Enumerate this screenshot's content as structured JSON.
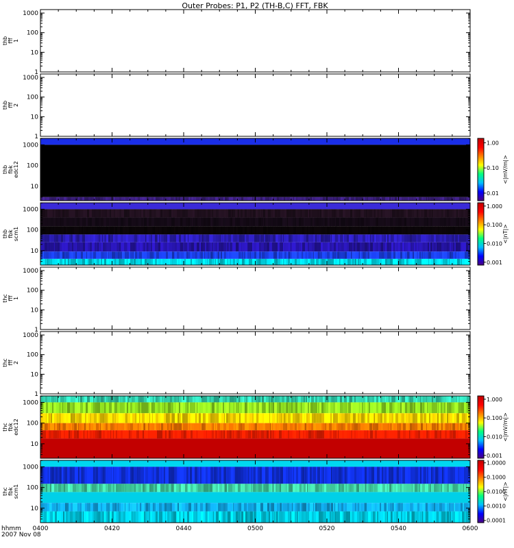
{
  "chart_data": {
    "type": "heatmap",
    "title": "Outer Probes: P1, P2 (TH-B,C) FFT, FBK",
    "x_axis": {
      "label_line1": "hhmm",
      "label_line2": "2007 Nov 08",
      "range": [
        "0400",
        "0600"
      ],
      "ticks": [
        "0400",
        "0420",
        "0440",
        "0500",
        "0520",
        "0540",
        "0600"
      ]
    },
    "panels": [
      {
        "ylabel": [
          "thb",
          "fff",
          "1"
        ],
        "yscale": "log",
        "yticks": [
          "1",
          "10",
          "100",
          "1000"
        ],
        "ylim": [
          1,
          1500
        ],
        "content": "empty",
        "colorbar": null
      },
      {
        "ylabel": [
          "thb",
          "fff",
          "2"
        ],
        "yscale": "log",
        "yticks": [
          "1",
          "10",
          "100",
          "1000"
        ],
        "ylim": [
          1,
          1500
        ],
        "content": "empty",
        "colorbar": null
      },
      {
        "ylabel": [
          "thb",
          "fbk",
          "edc12"
        ],
        "yscale": "log",
        "yticks": [
          "10",
          "100",
          "1000"
        ],
        "ylim": [
          2,
          2048
        ],
        "content": "spectrogram",
        "bands": [
          {
            "from": 1000,
            "to": 2048,
            "color": "#1a2ee8",
            "pattern": "solid"
          },
          {
            "from": 3.0,
            "to": 1000,
            "color": "#000000",
            "pattern": "solid"
          },
          {
            "from": 2,
            "to": 3.0,
            "color": "#3a1e7a",
            "pattern": "stripes"
          }
        ],
        "colorbar": {
          "label": "<|mV/m|>",
          "ticks": [
            "1.00",
            "0.10",
            "0.01"
          ],
          "range": [
            0.005,
            1.5
          ]
        }
      },
      {
        "ylabel": [
          "thb",
          "fbk",
          "scm1"
        ],
        "yscale": "log",
        "yticks": [
          "10",
          "100",
          "1000"
        ],
        "ylim": [
          2,
          2048
        ],
        "content": "spectrogram",
        "bands": [
          {
            "from": 1000,
            "to": 2048,
            "color": "#3a2ad8",
            "pattern": "solid"
          },
          {
            "from": 400,
            "to": 1000,
            "color": "#20101e",
            "pattern": "stripes"
          },
          {
            "from": 150,
            "to": 400,
            "color": "#140a16",
            "pattern": "stripes"
          },
          {
            "from": 60,
            "to": 150,
            "color": "#0a0508",
            "pattern": "stripes"
          },
          {
            "from": 25,
            "to": 60,
            "color": "#2a1cb0",
            "pattern": "stripes"
          },
          {
            "from": 9,
            "to": 25,
            "color": "#2614a8",
            "pattern": "stripes"
          },
          {
            "from": 4,
            "to": 9,
            "color": "#1a3ee6",
            "pattern": "stripes"
          },
          {
            "from": 2,
            "to": 4,
            "color": "#00d8e8",
            "pattern": "stripes"
          }
        ],
        "colorbar": {
          "label": "<|nT|>",
          "ticks": [
            "1.000",
            "0.100",
            "0.010",
            "0.001"
          ],
          "range": [
            0.0007,
            1.5
          ]
        }
      },
      {
        "ylabel": [
          "thc",
          "fff",
          "1"
        ],
        "yscale": "log",
        "yticks": [
          "1",
          "10",
          "100",
          "1000"
        ],
        "ylim": [
          1,
          1500
        ],
        "content": "empty",
        "colorbar": null
      },
      {
        "ylabel": [
          "thc",
          "fff",
          "2"
        ],
        "yscale": "log",
        "yticks": [
          "1",
          "10",
          "100",
          "1000"
        ],
        "ylim": [
          1,
          1500
        ],
        "content": "empty",
        "colorbar": null
      },
      {
        "ylabel": [
          "thc",
          "fbk",
          "edc12"
        ],
        "yscale": "log",
        "yticks": [
          "10",
          "100",
          "1000"
        ],
        "ylim": [
          2,
          2048
        ],
        "content": "spectrogram",
        "bands": [
          {
            "from": 1000,
            "to": 2048,
            "color": "#30d0b0",
            "pattern": "stripes"
          },
          {
            "from": 300,
            "to": 1000,
            "color": "#90e020",
            "pattern": "stripes"
          },
          {
            "from": 100,
            "to": 300,
            "color": "#ffd800",
            "pattern": "stripes"
          },
          {
            "from": 45,
            "to": 100,
            "color": "#ff7a00",
            "pattern": "stripes"
          },
          {
            "from": 18,
            "to": 45,
            "color": "#ff2000",
            "pattern": "stripes"
          },
          {
            "from": 2,
            "to": 18,
            "color": "#c20000",
            "pattern": "solid"
          }
        ],
        "colorbar": {
          "label": "<|mV/m|>",
          "ticks": [
            "1.000",
            "0.100",
            "0.010",
            "0.001"
          ],
          "range": [
            0.0007,
            1.5
          ]
        }
      },
      {
        "ylabel": [
          "thc",
          "fbk",
          "scm1"
        ],
        "yscale": "log",
        "yticks": [
          "10",
          "100",
          "1000"
        ],
        "ylim": [
          2,
          2048
        ],
        "content": "spectrogram",
        "bands": [
          {
            "from": 1000,
            "to": 2048,
            "color": "#00d8f0",
            "pattern": "solid"
          },
          {
            "from": 150,
            "to": 1000,
            "color": "#1030e0",
            "pattern": "stripes"
          },
          {
            "from": 60,
            "to": 150,
            "color": "#40d0a0",
            "pattern": "stripes"
          },
          {
            "from": 18,
            "to": 60,
            "color": "#00d0e8",
            "pattern": "solid"
          },
          {
            "from": 7,
            "to": 18,
            "color": "#10a8e8",
            "pattern": "stripes"
          },
          {
            "from": 2,
            "to": 7,
            "color": "#00c8e0",
            "pattern": "stripes"
          }
        ],
        "colorbar": {
          "label": "<|nT|>",
          "ticks": [
            "1.0000",
            "0.1000",
            "0.0100",
            "0.0010",
            "0.0001"
          ],
          "range": [
            7e-05,
            1.5
          ]
        }
      }
    ]
  }
}
